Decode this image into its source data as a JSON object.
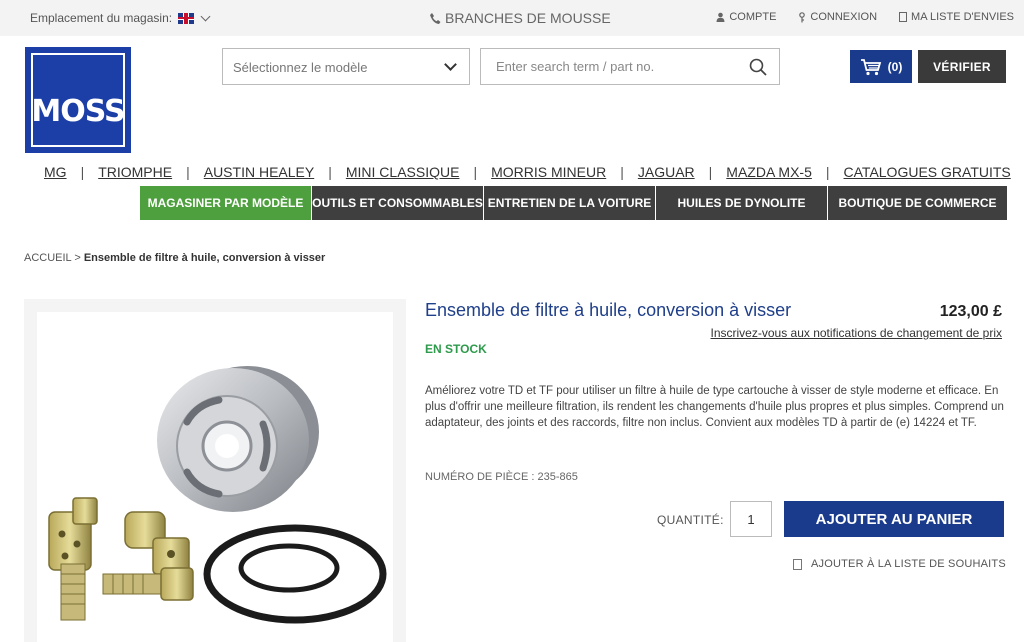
{
  "topbar": {
    "store_location_label": "Emplacement du magasin:",
    "branches_label": "BRANCHES DE MOUSSE",
    "account_label": "COMPTE",
    "login_label": "CONNEXION",
    "wishlist_label": "MA LISTE D'ENVIES"
  },
  "logo": {
    "text": "MOSS"
  },
  "header": {
    "model_select_value": "Sélectionnez le modèle",
    "search_placeholder": "Enter search term / part no.",
    "cart_count": "(0)",
    "verify_label": "VÉRIFIER"
  },
  "brand_nav": [
    "MG",
    "TRIOMPHE",
    "AUSTIN HEALEY",
    "MINI CLASSIQUE",
    "MORRIS MINEUR",
    "JAGUAR",
    "MAZDA MX-5",
    "CATALOGUES GRATUITS"
  ],
  "category_nav": [
    {
      "label": "MAGASINER PAR MODÈLE",
      "active": true
    },
    {
      "label": "OUTILS ET CONSOMMABLES",
      "active": false
    },
    {
      "label": "ENTRETIEN DE LA VOITURE",
      "active": false
    },
    {
      "label": "HUILES DE DYNOLITE",
      "active": false
    },
    {
      "label": "BOUTIQUE DE COMMERCE",
      "active": false
    }
  ],
  "breadcrumb": {
    "home": "ACCUEIL",
    "separator": ">",
    "current": "Ensemble de filtre à huile, conversion à visser"
  },
  "product": {
    "title": "Ensemble de filtre à huile, conversion à visser",
    "price": "123,00 £",
    "price_notify": "Inscrivez-vous aux notifications de changement de prix",
    "stock": "EN STOCK",
    "description": "Améliorez votre TD et TF pour utiliser un filtre à huile de type cartouche à visser de style moderne et efficace. En plus d'offrir une meilleure filtration, ils rendent les changements d'huile plus propres et plus simples. Comprend un adaptateur, des joints et des raccords, filtre non inclus. Convient aux modèles TD à partir de (e) 14224 et TF.",
    "part_number": "NUMÉRO DE PIÈCE : 235-865",
    "quantity_label": "QUANTITÉ:",
    "quantity_value": "1",
    "add_to_cart": "AJOUTER AU PANIER",
    "add_to_wishlist": "AJOUTER À LA LISTE DE SOUHAITS"
  },
  "colors": {
    "brand_blue": "#1a3a8c",
    "nav_dark": "#3f3f3f",
    "nav_active": "#4e9f3d",
    "stock_green": "#2e9a4b",
    "title_blue": "#1f3f8a"
  }
}
